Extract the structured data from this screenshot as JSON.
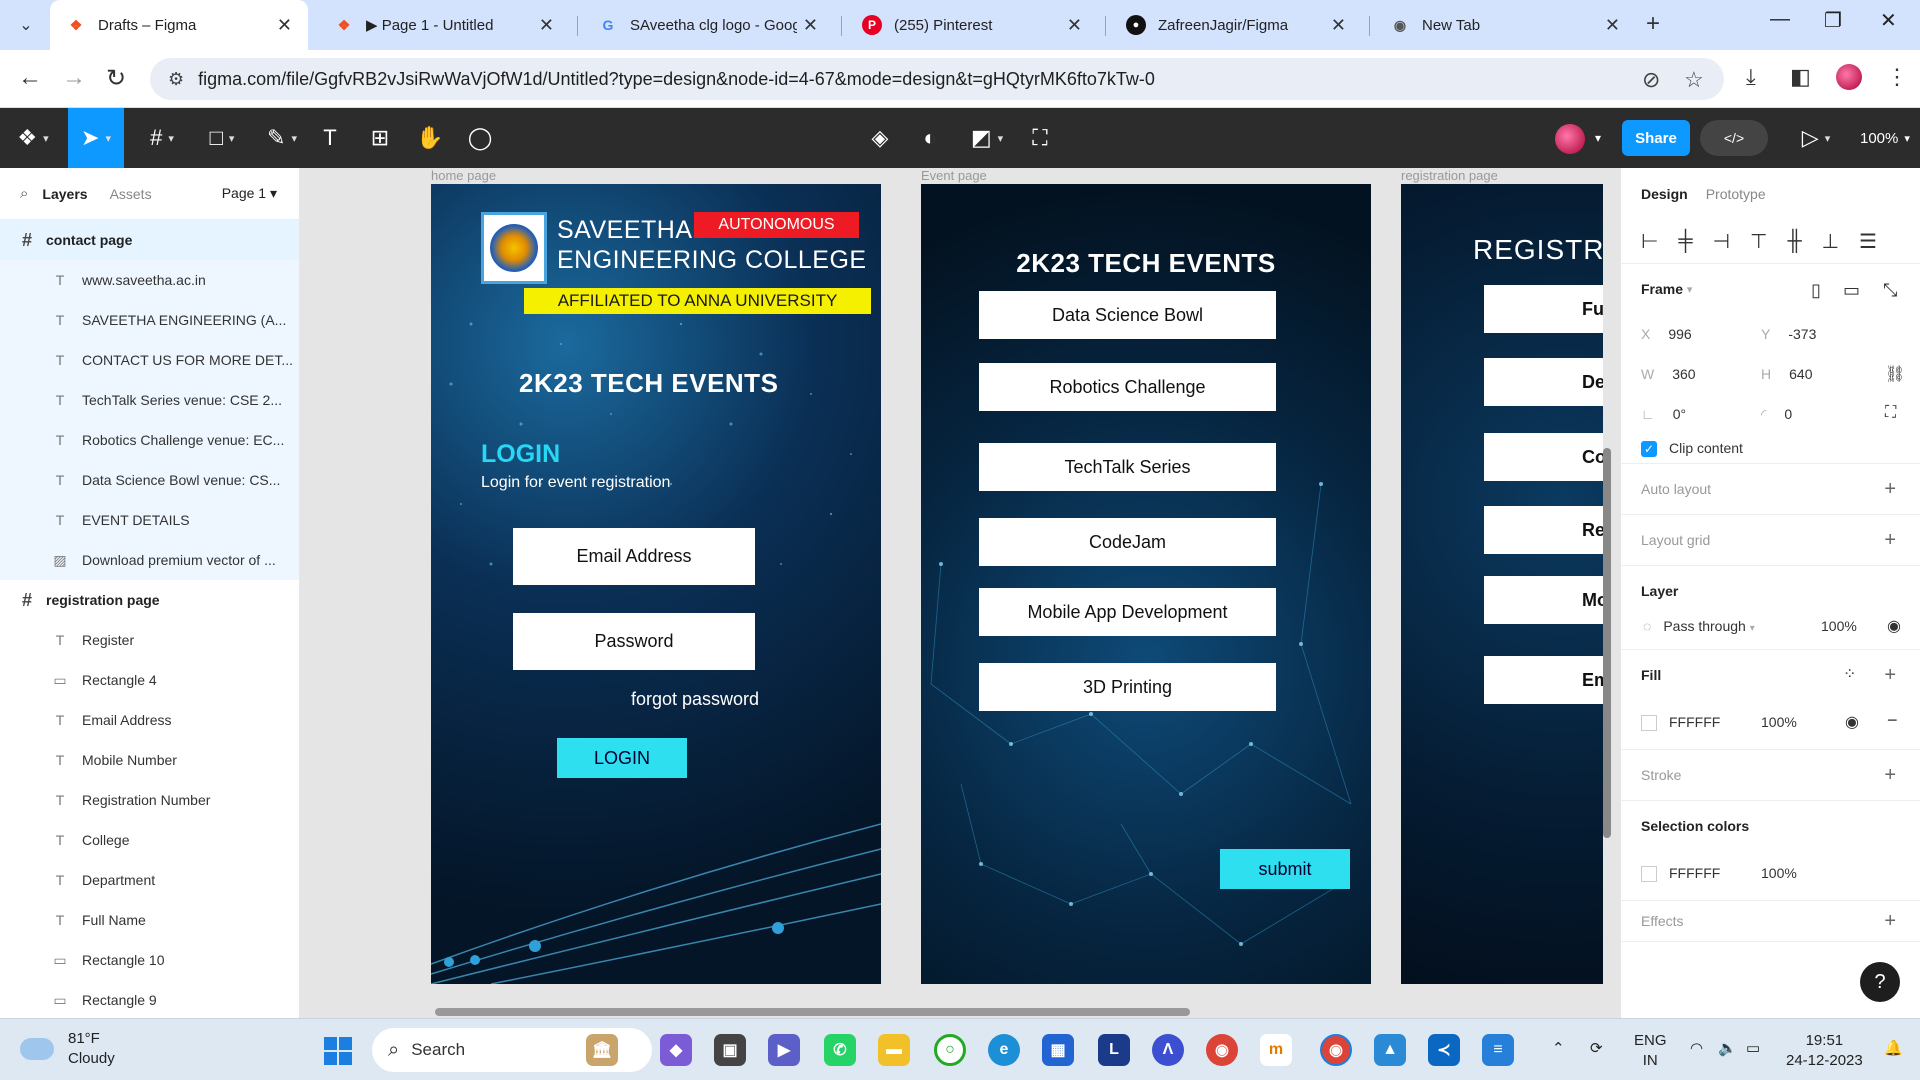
{
  "browser": {
    "tabs": [
      {
        "title": "Drafts – Figma",
        "icon": "figma-icon",
        "active": true
      },
      {
        "title": "▶ Page 1 - Untitled",
        "icon": "figma-icon"
      },
      {
        "title": "SAveetha clg logo - Googl",
        "icon": "google-icon"
      },
      {
        "title": "(255) Pinterest",
        "icon": "pinterest-icon"
      },
      {
        "title": "ZafreenJagir/Figma",
        "icon": "github-icon"
      },
      {
        "title": "New Tab",
        "icon": "chrome-icon"
      }
    ],
    "url": "figma.com/file/GgfvRB2vJsiRwWaVjOfW1d/Untitled?type=design&node-id=4-67&mode=design&t=gHQtyrMK6fto7kTw-0"
  },
  "figma_toolbar": {
    "share_label": "Share",
    "dev_label": "</>",
    "zoom": "100%"
  },
  "left_panel": {
    "tabs": {
      "layers": "Layers",
      "assets": "Assets",
      "page": "Page 1"
    },
    "layers": [
      {
        "label": "contact page",
        "type": "frame",
        "icon": "#",
        "hl": "hl"
      },
      {
        "label": "www.saveetha.ac.in",
        "type": "child",
        "icon": "T",
        "hl": "hl2"
      },
      {
        "label": "SAVEETHA ENGINEERING (A...",
        "type": "child",
        "icon": "T",
        "hl": "hl2"
      },
      {
        "label": "CONTACT US FOR MORE DET...",
        "type": "child",
        "icon": "T",
        "hl": "hl2"
      },
      {
        "label": "TechTalk Series venue: CSE 2...",
        "type": "child",
        "icon": "T",
        "hl": "hl2"
      },
      {
        "label": "Robotics Challenge venue: EC...",
        "type": "child",
        "icon": "T",
        "hl": "hl2"
      },
      {
        "label": "Data Science Bowl venue: CS...",
        "type": "child",
        "icon": "T",
        "hl": "hl2"
      },
      {
        "label": "EVENT DETAILS",
        "type": "child",
        "icon": "T",
        "hl": "hl2"
      },
      {
        "label": "Download premium vector of ...",
        "type": "child",
        "icon": "▨",
        "hl": "hl2"
      },
      {
        "label": "registration page",
        "type": "frame",
        "icon": "#",
        "hl": ""
      },
      {
        "label": "Register",
        "type": "child",
        "icon": "T",
        "hl": ""
      },
      {
        "label": "Rectangle 4",
        "type": "child",
        "icon": "▭",
        "hl": ""
      },
      {
        "label": "Email Address",
        "type": "child",
        "icon": "T",
        "hl": ""
      },
      {
        "label": "Mobile Number",
        "type": "child",
        "icon": "T",
        "hl": ""
      },
      {
        "label": "Registration Number",
        "type": "child",
        "icon": "T",
        "hl": ""
      },
      {
        "label": "College",
        "type": "child",
        "icon": "T",
        "hl": ""
      },
      {
        "label": "Department",
        "type": "child",
        "icon": "T",
        "hl": ""
      },
      {
        "label": "Full Name",
        "type": "child",
        "icon": "T",
        "hl": ""
      },
      {
        "label": "Rectangle 10",
        "type": "child",
        "icon": "▭",
        "hl": ""
      },
      {
        "label": "Rectangle 9",
        "type": "child",
        "icon": "▭",
        "hl": ""
      }
    ]
  },
  "canvas": {
    "frames": {
      "home": "home page",
      "event": "Event page",
      "registration": "registration page"
    },
    "home": {
      "college_line1": "SAVEETHA",
      "college_line2": "ENGINEERING COLLEGE",
      "autonomous": "AUTONOMOUS",
      "affiliated": "AFFILIATED TO ANNA UNIVERSITY",
      "title": "2K23  TECH EVENTS",
      "login_heading": "LOGIN",
      "login_sub": "Login for event registration",
      "email": "Email Address",
      "password": "Password",
      "forgot": "forgot password",
      "login_btn": "LOGIN"
    },
    "event": {
      "title": "2K23  TECH EVENTS",
      "events": [
        "Data Science Bowl",
        "Robotics Challenge",
        "TechTalk Series",
        "CodeJam",
        "Mobile App Development",
        "3D Printing"
      ],
      "submit": "submit"
    },
    "registration": {
      "title": "REGISTRAT",
      "fields": [
        "Full l",
        "Depa",
        "Co",
        "Registra",
        "Mobile",
        "Email A"
      ]
    }
  },
  "right_panel": {
    "tabs": {
      "design": "Design",
      "prototype": "Prototype"
    },
    "frame_label": "Frame",
    "x": "996",
    "y": "-373",
    "w": "360",
    "h": "640",
    "rotation": "0°",
    "radius": "0",
    "clip": "Clip content",
    "auto_layout": "Auto layout",
    "layout_grid": "Layout grid",
    "layer_label": "Layer",
    "blend": "Pass through",
    "layer_opacity": "100%",
    "fill_label": "Fill",
    "fill_hex": "FFFFFF",
    "fill_opacity": "100%",
    "stroke_label": "Stroke",
    "selection_colors": "Selection colors",
    "sel_hex": "FFFFFF",
    "sel_opacity": "100%",
    "effects": "Effects"
  },
  "taskbar": {
    "temp": "81°F",
    "condition": "Cloudy",
    "search": "Search",
    "lang1": "ENG",
    "lang2": "IN",
    "time": "19:51",
    "date": "24-12-2023"
  }
}
